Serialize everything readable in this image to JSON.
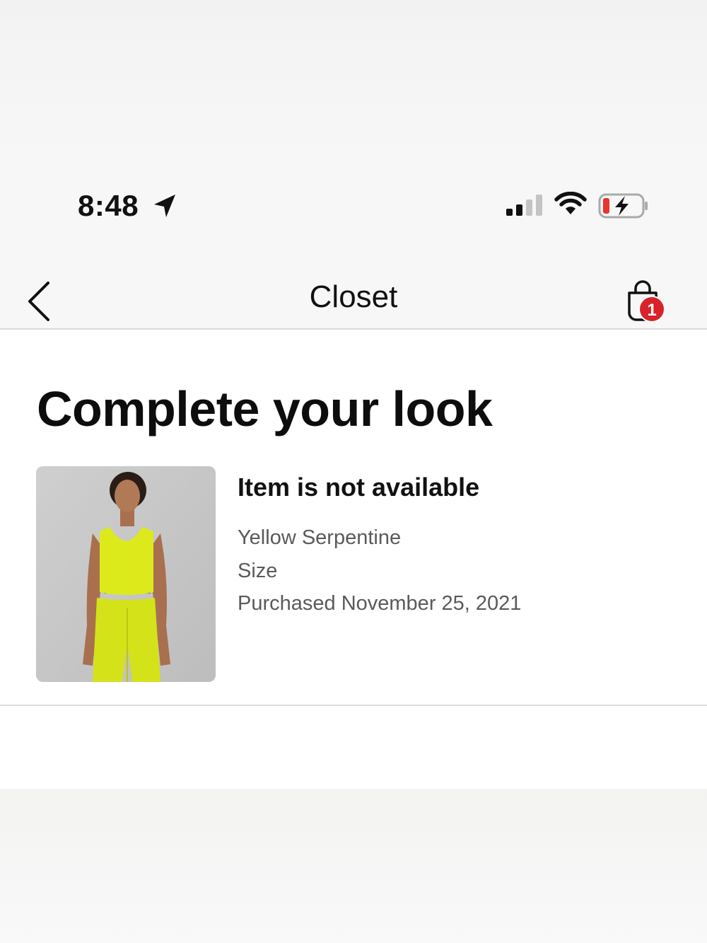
{
  "status_bar": {
    "time": "8:48",
    "location_icon": "location-arrow-icon",
    "signal_icon": "cellular-signal-icon",
    "wifi_icon": "wifi-icon",
    "battery_icon": "battery-charging-icon"
  },
  "nav": {
    "back_icon": "chevron-left-icon",
    "title": "Closet",
    "bag_icon": "shopping-bag-icon",
    "bag_count": "1",
    "badge_color": "#d8232a"
  },
  "main": {
    "section_title": "Complete your look",
    "product": {
      "status": "Item is not available",
      "color": "Yellow Serpentine",
      "size_label": "Size",
      "purchased": "Purchased November 25, 2021",
      "accent_color": "#dcea1c"
    }
  }
}
